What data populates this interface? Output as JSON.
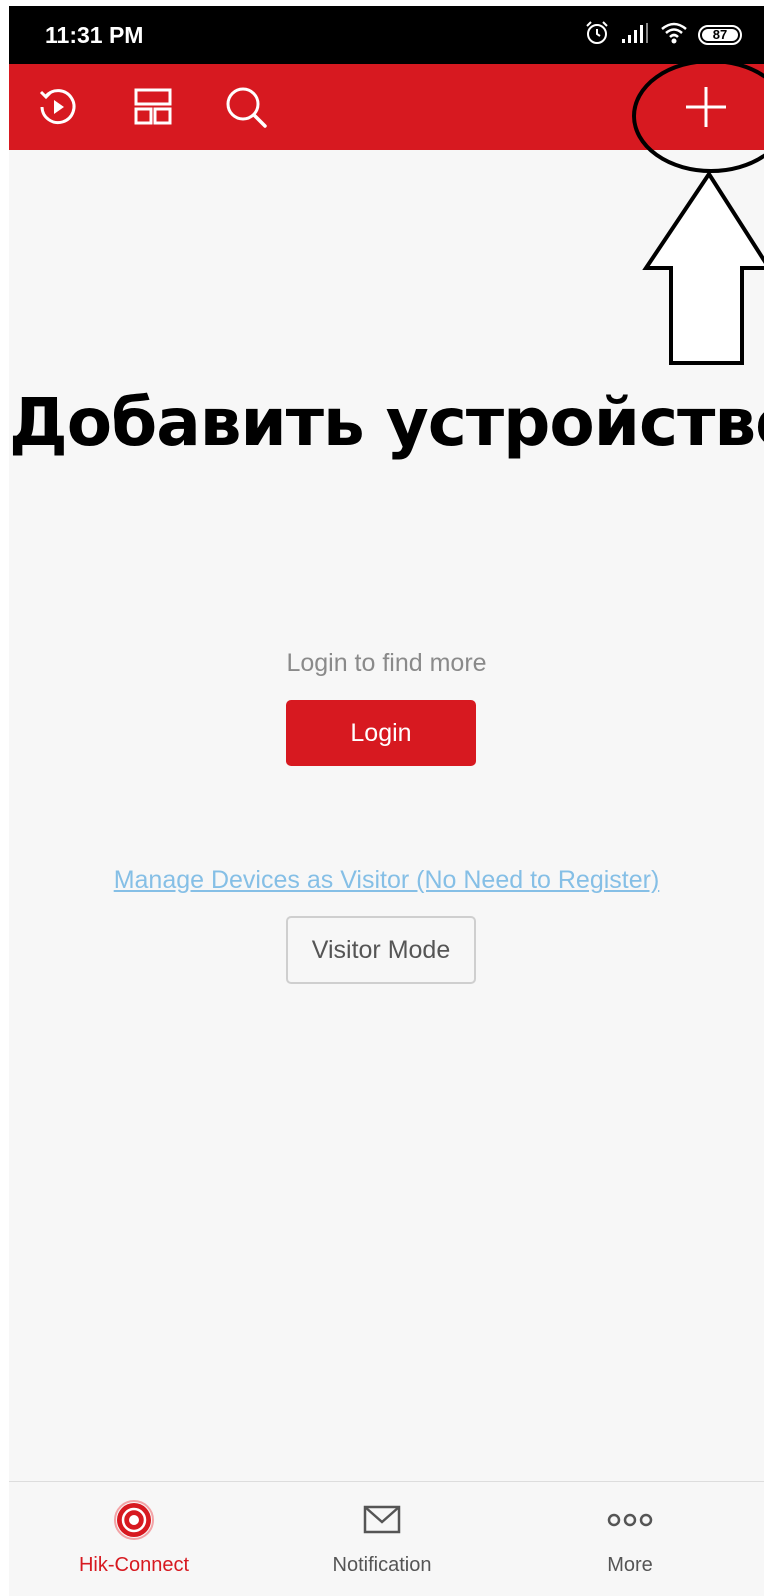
{
  "status_bar": {
    "time": "11:31 PM",
    "battery_level": "87",
    "icons": [
      "alarm-icon",
      "signal-icon",
      "wifi-icon",
      "battery-icon"
    ]
  },
  "toolbar": {
    "background_color": "#d71920",
    "buttons": [
      "playback-icon",
      "layout-icon",
      "search-icon",
      "add-icon"
    ]
  },
  "annotation": {
    "caption": "Добавить устройство"
  },
  "main": {
    "prompt": "Login to find more",
    "login_label": "Login",
    "visitor_link": "Manage Devices as Visitor (No Need to Register)",
    "visitor_button_label": "Visitor Mode"
  },
  "bottom_nav": {
    "items": [
      {
        "label": "Hik-Connect",
        "icon": "hik-connect-icon",
        "active": true,
        "color": "#d71920"
      },
      {
        "label": "Notification",
        "icon": "envelope-icon",
        "active": false
      },
      {
        "label": "More",
        "icon": "more-dots-icon",
        "active": false
      }
    ]
  }
}
